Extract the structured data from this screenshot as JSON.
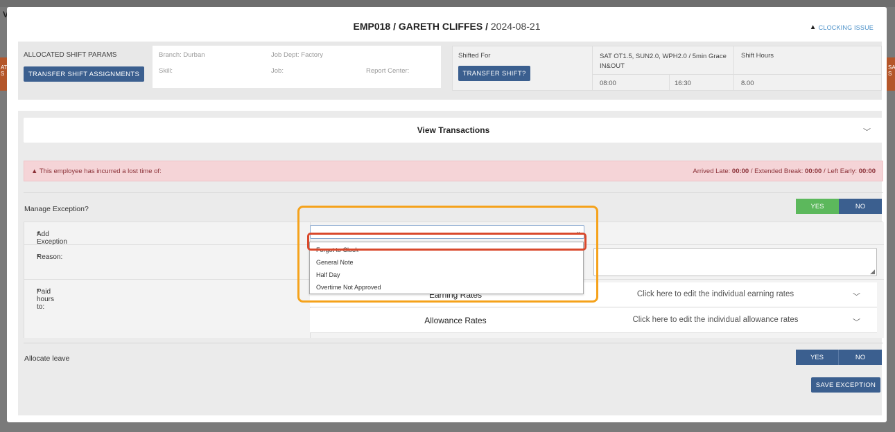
{
  "background": {
    "left_letter": "V",
    "left_tab": "AT\nS",
    "right_tab": "SA\nS"
  },
  "header": {
    "employee": "EMP018 / GARETH CLIFFES /",
    "date": "2024-08-21",
    "clocking_issue": "CLOCKING ISSUE"
  },
  "params": {
    "allocated_label": "ALLOCATED SHIFT PARAMS",
    "transfer_assignments_button": "TRANSFER SHIFT ASSIGNMENTS",
    "branch": "Branch: Durban",
    "job_dept": "Job Dept: Factory",
    "skill": "Skill:",
    "job": "Job:",
    "report_center": "Report Center:",
    "shifted_for_label": "Shifted For",
    "transfer_shift_button": "TRANSFER SHIFT?",
    "shift_rules": "SAT OT1.5, SUN2.0, WPH2.0 / 5min Grace IN&OUT",
    "shift_hours_label": "Shift Hours",
    "start_time": "08:00",
    "end_time": "16:30",
    "hours": "8.00"
  },
  "transactions": {
    "label": "View Transactions"
  },
  "alert": {
    "message": "This employee has incurred a lost time of:",
    "arrived_late_label": "Arrived Late:",
    "arrived_late": "00:00",
    "extended_break_label": "/ Extended Break:",
    "extended_break": "00:00",
    "left_early_label": "/ Left Early:",
    "left_early": "00:00"
  },
  "exception": {
    "manage_label": "Manage Exception?",
    "yes": "YES",
    "no": "NO",
    "add_exception_label": "Add Exception",
    "reason_label": "Reason:",
    "paid_hours_label": "Paid hours to:",
    "required_mark": "*",
    "select_value": "",
    "dropdown_options": [
      "Forgot to Clock",
      "General Note",
      "Half Day",
      "Overtime Not Approved"
    ]
  },
  "rates": {
    "earning_name": "Earning Rates",
    "earning_hint": "Click here to edit the individual earning rates",
    "allowance_name": "Allowance Rates",
    "allowance_hint": "Click here to edit the individual allowance rates"
  },
  "leave": {
    "allocate_label": "Allocate leave",
    "yes": "YES",
    "no": "NO"
  },
  "save_button": "SAVE EXCEPTION",
  "colors": {
    "primary_button": "#3b5f8f",
    "success": "#5cb85c",
    "alert_bg": "#f5d4d7",
    "highlight_outer": "#f5a21b",
    "highlight_inner": "#d9482b"
  }
}
